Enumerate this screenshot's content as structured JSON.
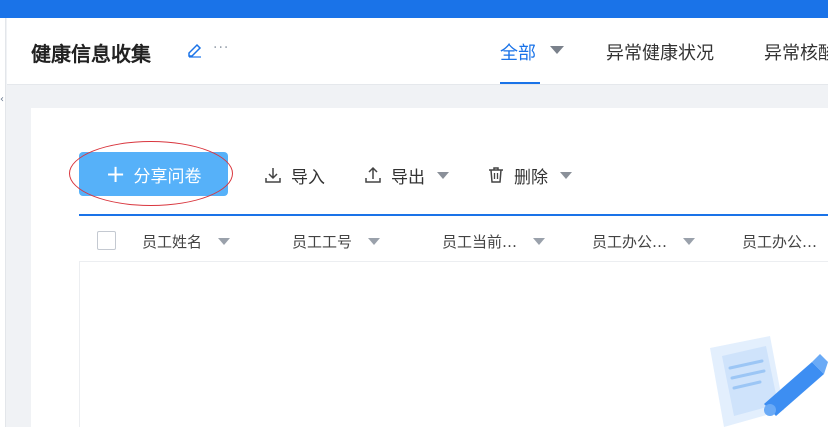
{
  "colors": {
    "topbar": "#1a73e8",
    "accent": "#1a73e8",
    "share_button": "#56b1f9",
    "annotation": "#d9363e"
  },
  "header": {
    "title": "健康信息收集",
    "edit_icon": "edit-icon",
    "more_icon": "more-icon",
    "more_glyph": "···",
    "tabs": [
      {
        "label": "全部",
        "active": true,
        "has_dropdown": true
      },
      {
        "label": "异常健康状况",
        "active": false
      },
      {
        "label": "异常核酸",
        "active": false
      }
    ]
  },
  "toolbar": {
    "share_label": "分享问卷",
    "share_icon": "plus-icon",
    "import_label": "导入",
    "import_icon": "download-icon",
    "export_label": "导出",
    "export_icon": "upload-icon",
    "delete_label": "删除",
    "delete_icon": "trash-icon"
  },
  "table": {
    "columns": [
      {
        "label": "员工姓名"
      },
      {
        "label": "员工工号"
      },
      {
        "label": "员工当前…"
      },
      {
        "label": "员工办公…"
      },
      {
        "label": "员工办公…"
      }
    ],
    "rows": []
  },
  "empty_state": {
    "icon": "empty-document-illustration"
  }
}
